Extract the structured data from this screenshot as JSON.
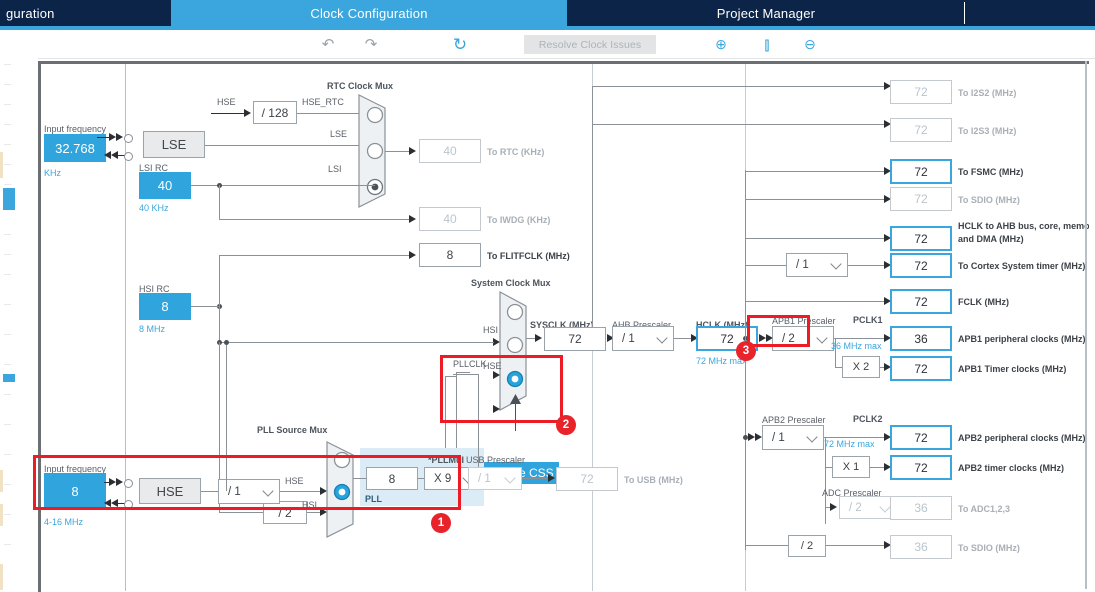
{
  "app": {
    "tabs": [
      {
        "label": "guration",
        "state": "inactive",
        "truncated": true
      },
      {
        "label": "Clock Configuration",
        "state": "active"
      },
      {
        "label": "Project Manager",
        "state": "inactive"
      }
    ]
  },
  "toolbar": {
    "undo_icon": "undo-icon",
    "redo_icon": "redo-icon",
    "reset_icon": "reset-icon",
    "resolve_button": "Resolve Clock Issues",
    "zoom_in_icon": "zoom-in-icon",
    "fit_icon": "fit-to-screen-icon",
    "zoom_out_icon": "zoom-out-icon"
  },
  "diagram": {
    "lse": {
      "input_frequency_label": "Input frequency",
      "input_frequency_value": "32.768",
      "unit_label": "KHz",
      "osc_label": "LSE"
    },
    "hse": {
      "input_frequency_label": "Input frequency",
      "input_frequency_value": "8",
      "unit_label": "4-16 MHz",
      "osc_label": "HSE",
      "prescaler_value": "/ 1"
    },
    "lsi": {
      "title": "LSI RC",
      "value": "40",
      "unit": "40 KHz"
    },
    "hsi": {
      "title": "HSI RC",
      "value": "8",
      "unit": "8 MHz"
    },
    "hse_div128": {
      "input_label": "HSE",
      "value": "/ 128",
      "output_label": "HSE_RTC"
    },
    "rtc_mux": {
      "title": "RTC Clock Mux",
      "inputs": [
        "HSE_RTC",
        "LSE",
        "LSI"
      ],
      "selected_index": 2
    },
    "to_rtc": {
      "value": "40",
      "label": "To RTC (KHz)"
    },
    "to_iwdg": {
      "value": "40",
      "label": "To IWDG (KHz)"
    },
    "to_flitfclk": {
      "value": "8",
      "label": "To FLITFCLK (MHz)"
    },
    "sys_mux": {
      "title": "System Clock Mux",
      "inputs": [
        "HSI",
        "HSE",
        "PLLCLK"
      ],
      "selected_index": 2,
      "css_button": "Enable CSS"
    },
    "sysclk": {
      "title": "SYSCLK (MHz)",
      "value": "72"
    },
    "ahb_prescaler": {
      "title": "AHB Prescaler",
      "value": "/ 1"
    },
    "hclk": {
      "title": "HCLK (MHz)",
      "value": "72",
      "max_note": "72 MHz max"
    },
    "pll_source_mux": {
      "title": "PLL Source Mux",
      "inputs": [
        "HSI",
        "HSE"
      ],
      "selected_index": 1,
      "hsi_div2": "/ 2"
    },
    "pll": {
      "group_label": "PLL",
      "input_value": "8",
      "mul_label": "*PLLMul",
      "mul_value": "X 9"
    },
    "usb_prescaler": {
      "title": "USB Prescaler",
      "value": "/ 1"
    },
    "to_usb": {
      "value": "72",
      "label": "To USB (MHz)"
    },
    "outputs": [
      {
        "value": "72",
        "label": "To I2S2 (MHz)",
        "enabled": false
      },
      {
        "value": "72",
        "label": "To I2S3 (MHz)",
        "enabled": false
      },
      {
        "value": "72",
        "label": "To FSMC (MHz)",
        "enabled": true
      },
      {
        "value": "72",
        "label": "To SDIO (MHz)",
        "enabled": false
      },
      {
        "value": "72",
        "label": "HCLK to AHB bus, core, memory and DMA (MHz)",
        "enabled": true
      },
      {
        "value": "72",
        "label": "To Cortex System timer (MHz)",
        "enabled": true
      },
      {
        "value": "72",
        "label": "FCLK (MHz)",
        "enabled": true
      }
    ],
    "cortex_prescaler": {
      "value": "/ 1"
    },
    "apb1": {
      "prescaler_title": "APB1 Prescaler",
      "prescaler_value": "/ 2",
      "pclk_label": "PCLK1",
      "max_note": "36 MHz max",
      "periph": {
        "value": "36",
        "label": "APB1 peripheral clocks (MHz)"
      },
      "timer_mul": "X 2",
      "timer": {
        "value": "72",
        "label": "APB1 Timer clocks (MHz)"
      }
    },
    "apb2": {
      "prescaler_title": "APB2 Prescaler",
      "prescaler_value": "/ 1",
      "pclk_label": "PCLK2",
      "max_note": "72 MHz max",
      "periph": {
        "value": "72",
        "label": "APB2 peripheral clocks (MHz)"
      },
      "timer_mul": "X 1",
      "timer": {
        "value": "72",
        "label": "APB2 timer clocks (MHz)"
      }
    },
    "adc": {
      "prescaler_title": "ADC Prescaler",
      "prescaler_value": "/ 2",
      "out": {
        "value": "36",
        "label": "To ADC1,2,3"
      }
    },
    "sdio2": {
      "div": "/ 2",
      "value": "36",
      "label": "To SDIO (MHz)"
    }
  },
  "annotations": {
    "badges": [
      "1",
      "2",
      "3"
    ],
    "highlight_color": "#ed1c24"
  }
}
